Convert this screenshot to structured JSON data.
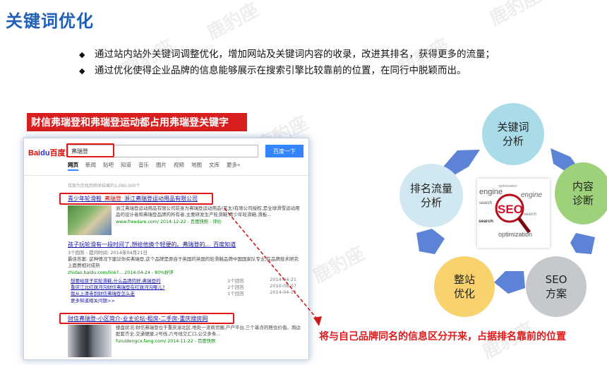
{
  "title": "关键词优化",
  "bullets": [
    "通过站内站外关键词调整优化，增加网站及关键词内容的收录，改进其排名，获得更多的流量；",
    "通过优化使得企业品牌的信息能够展示在搜索引擎比较靠前的位置，在同行中脱颖而出。"
  ],
  "bullet_glyph": "◆",
  "watermark": "鹿豹座",
  "banner": "财信弗瑞登和弗瑞登运动都占用弗瑞登关键字",
  "baidu": {
    "logo_left": "Bai",
    "logo_paw": "du",
    "logo_right": "百度",
    "query": "弗瑞登",
    "search_button": "百度一下",
    "tabs": [
      "网页",
      "新闻",
      "贴吧",
      "知道",
      "音乐",
      "图片",
      "视频",
      "地图",
      "文库",
      "更多»"
    ],
    "result_count": "百度为您找到相关结果约1,080,000个",
    "results": [
      {
        "title_a": "青少年轮滑鞋_",
        "title_hl": "弗瑞登",
        "title_b": "_浙江弗瑞登运动用品有限公司",
        "snippet": "浙江弗瑞登运动用品有限公司前身为弗瑞登运动用品(亚太)有限公司授权,是全球滑雪运动用品的设计者和弗瑞登品牌的所有者,主要研发生产轮滑鞋,青少年轮滑鞋,滑板...",
        "url": "www.freedare.com/ 2014-12-22 - 百度快照 - 评价"
      },
      {
        "title": "孩子玩轮滑有一段时间了,想给他换个轻便的。弗瑞登的..._百度知道",
        "meta": "3个回答 - 提问时间: 2014年04月21日",
        "snippet": "最佳答案: 这种情况下建议你买弗瑞登,这个品牌是原自于英国的英国的轮滑鞋品牌中国国家队专业,在品牌技术研究上面费相对成熟",
        "url": "zhidao.baidu.com/link?... 2014-04-24 - 80%好评",
        "subs": [
          {
            "q": "想要给孩子买轮滑鞋,什么品牌的好,弗瑞登的",
            "n": "2个回答",
            "d": "2014-04-21"
          },
          {
            "q": "重庆江北红旗河沟财信弗瑞登在红旗河沟哪儿?",
            "n": "2个回答",
            "d": "2010-08-07"
          },
          {
            "q": "我从上清寺到财信弗瑞登怎么走",
            "n": "1个回答",
            "d": "2014-04-11"
          }
        ],
        "more": "更多知道相关问题>>"
      },
      {
        "title": "财信弗瑞登-小区简介-业主论坛-租房-二手房-重庆搜房网",
        "snippet": "楼盘状况:财信弗瑞登位于重庆渝北区,地处一流商贸圈,户户平台,三个基点的居住价值。周边配套齐全,交通便捷,2号线,六号线交汇口,公交多条...",
        "url": "furuidengcx.fang.com/ 2014-11-22 - 百度快照"
      }
    ]
  },
  "callout": "将与自己品牌同名的信息区分开来，占据排名靠前的位置",
  "diagram": {
    "nodes": [
      {
        "id": "keyword-analysis",
        "label": "关键词\n分析",
        "color": "#a9dbe9"
      },
      {
        "id": "content-diagnosis",
        "label": "内容\n诊断",
        "color": "#9ed27a"
      },
      {
        "id": "seo-plan",
        "label": "SEO\n方案",
        "color": "#c6c9cb"
      },
      {
        "id": "site-optimization",
        "label": "整站\n优化",
        "color": "#f8d26d"
      },
      {
        "id": "ranking-traffic",
        "label": "排名流量\n分析",
        "color": "#d1e8f2"
      }
    ],
    "arrow_color": "#5d83d6",
    "seo_image_words": [
      "optimization",
      "engine",
      "engine",
      "search",
      "SEO",
      "search",
      "search",
      "optimization"
    ]
  }
}
